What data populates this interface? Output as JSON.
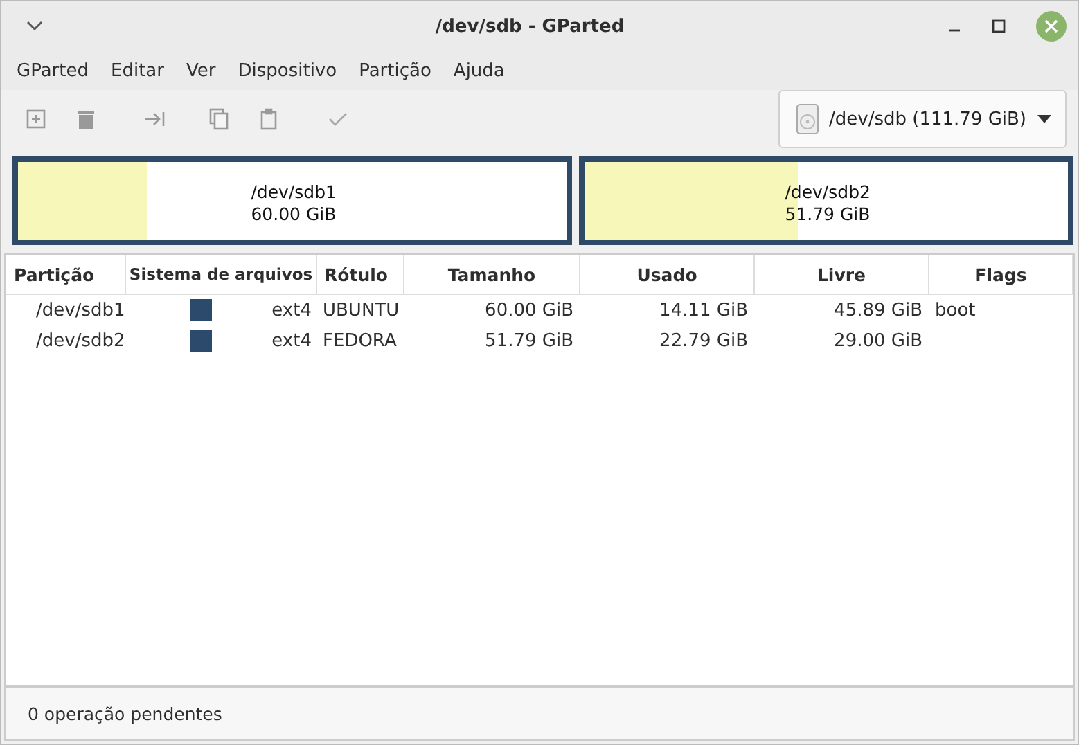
{
  "window": {
    "title": "/dev/sdb - GParted"
  },
  "menu": [
    "GParted",
    "Editar",
    "Ver",
    "Dispositivo",
    "Partição",
    "Ajuda"
  ],
  "device": {
    "label": "/dev/sdb (111.79 GiB)"
  },
  "map": [
    {
      "name": "/dev/sdb1",
      "size": "60.00 GiB",
      "level": 0.235
    },
    {
      "name": "/dev/sdb2",
      "size": "51.79 GiB",
      "level": 0.44
    }
  ],
  "table": {
    "columns": [
      "Partição",
      "Sistema de arquivos",
      "Rótulo",
      "Tamanho",
      "Usado",
      "Livre",
      "Flags"
    ],
    "rows": [
      {
        "partition": "/dev/sdb1",
        "color": "#2c4a6b",
        "filesystem": "ext4",
        "label": "UBUNTU",
        "size": "60.00 GiB",
        "used": "14.11 GiB",
        "free": "45.89 GiB",
        "flags": "boot"
      },
      {
        "partition": "/dev/sdb2",
        "color": "#2c4a6b",
        "filesystem": "ext4",
        "label": "FEDORA",
        "size": "51.79 GiB",
        "used": "22.79 GiB",
        "free": "29.00 GiB",
        "flags": ""
      }
    ]
  },
  "status_bar": "0 operação pendentes"
}
